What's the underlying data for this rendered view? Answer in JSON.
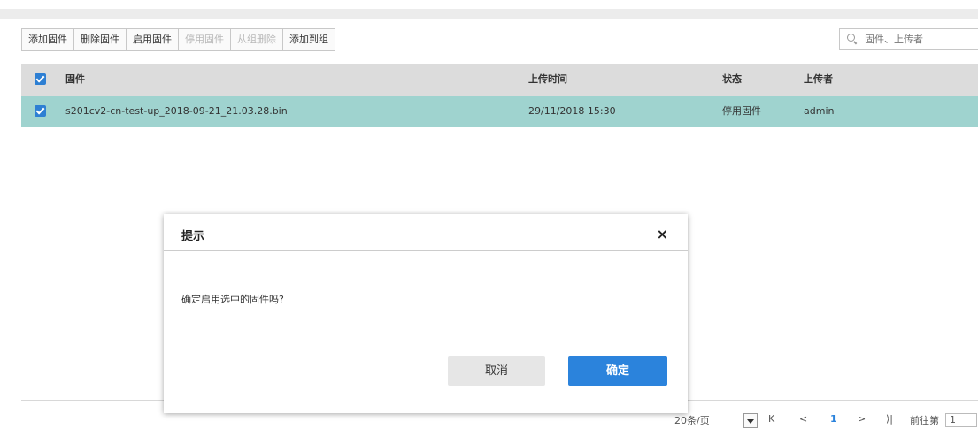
{
  "toolbar": {
    "buttons": [
      {
        "label": "添加固件",
        "disabled": false
      },
      {
        "label": "删除固件",
        "disabled": false
      },
      {
        "label": "启用固件",
        "disabled": false
      },
      {
        "label": "停用固件",
        "disabled": true
      },
      {
        "label": "从组删除",
        "disabled": true
      },
      {
        "label": "添加到组",
        "disabled": false
      }
    ]
  },
  "search": {
    "placeholder": "固件、上传者",
    "icon": "search-icon"
  },
  "table": {
    "headers": [
      "固件",
      "上传时间",
      "状态",
      "上传者"
    ],
    "rows": [
      {
        "name": "s201cv2-cn-test-up_2018-09-21_21.03.28.bin",
        "time": "29/11/2018 15:30",
        "status": "停用固件",
        "uploader": "admin",
        "checked": true
      }
    ],
    "header_checked": true,
    "selected_row_color": "#9fd3cf"
  },
  "dialog": {
    "title": "提示",
    "close_icon": "×",
    "message": "确定启用选中的固件吗?",
    "cancel": "取消",
    "confirm": "确定",
    "confirm_color": "#2b83dc"
  },
  "pager": {
    "page_size": "20条/页",
    "first": "K",
    "prev": "<",
    "current": "1",
    "next": ">",
    "last": "⟩|",
    "goto_label": "前往第",
    "goto_value": "1"
  }
}
